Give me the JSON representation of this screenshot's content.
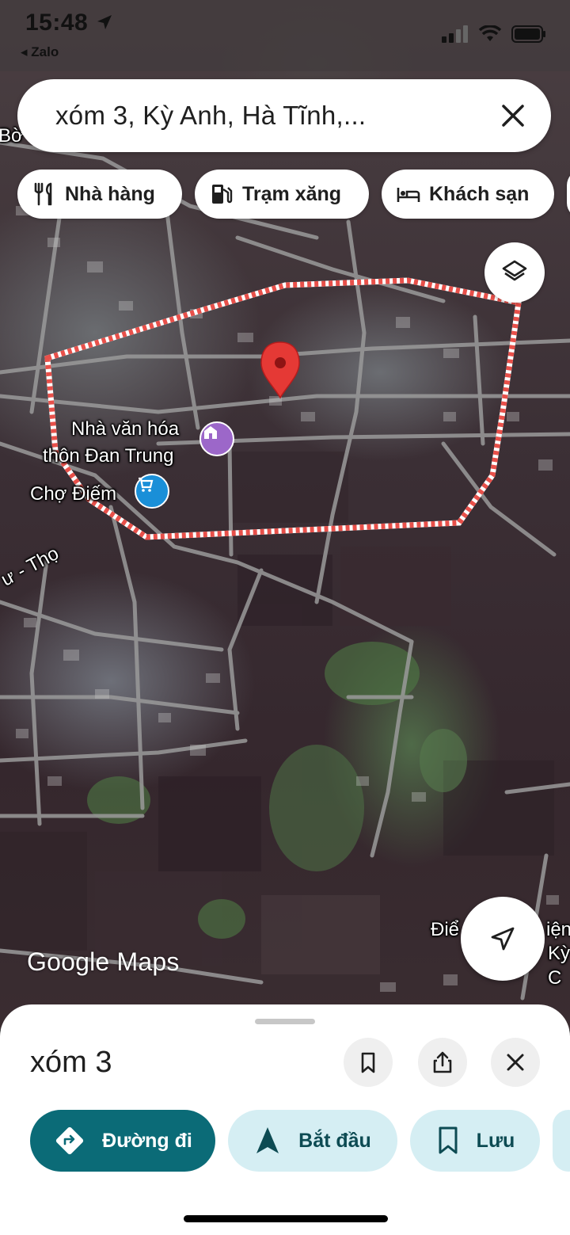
{
  "status_bar": {
    "time": "15:48",
    "back_app": "◂ Zalo"
  },
  "search": {
    "query": "xóm 3, Kỳ Anh, Hà Tĩnh,..."
  },
  "chips": [
    {
      "label": "Nhà hàng",
      "icon": "restaurant-icon"
    },
    {
      "label": "Trạm xăng",
      "icon": "gas-station-icon"
    },
    {
      "label": "Khách sạn",
      "icon": "hotel-icon"
    }
  ],
  "map": {
    "labels": {
      "cultural_house_line1": "Nhà văn hóa",
      "cultural_house_line2": "thôn Đan Trung",
      "market": "Chợ Điếm",
      "road_fragment": "ư - Thọ",
      "bottom_right_line1": "Điể",
      "bottom_right_line2": "iện",
      "bottom_right_line3": "Kỳ C",
      "top_left_fragment": "Bờ"
    },
    "watermark": "Google Maps",
    "boundary_color": "#e8504a",
    "pin_color": "#e53935"
  },
  "sheet": {
    "title": "xóm 3",
    "actions": [
      {
        "label": "Đường đi",
        "icon": "directions-icon",
        "bg": "#0b6b77",
        "fg": "#ffffff"
      },
      {
        "label": "Bắt đầu",
        "icon": "navigation-arrow-icon",
        "bg": "#d5eef3",
        "fg": "#0d4b53"
      },
      {
        "label": "Lưu",
        "icon": "bookmark-icon",
        "bg": "#d5eef3",
        "fg": "#0d4b53"
      }
    ]
  }
}
